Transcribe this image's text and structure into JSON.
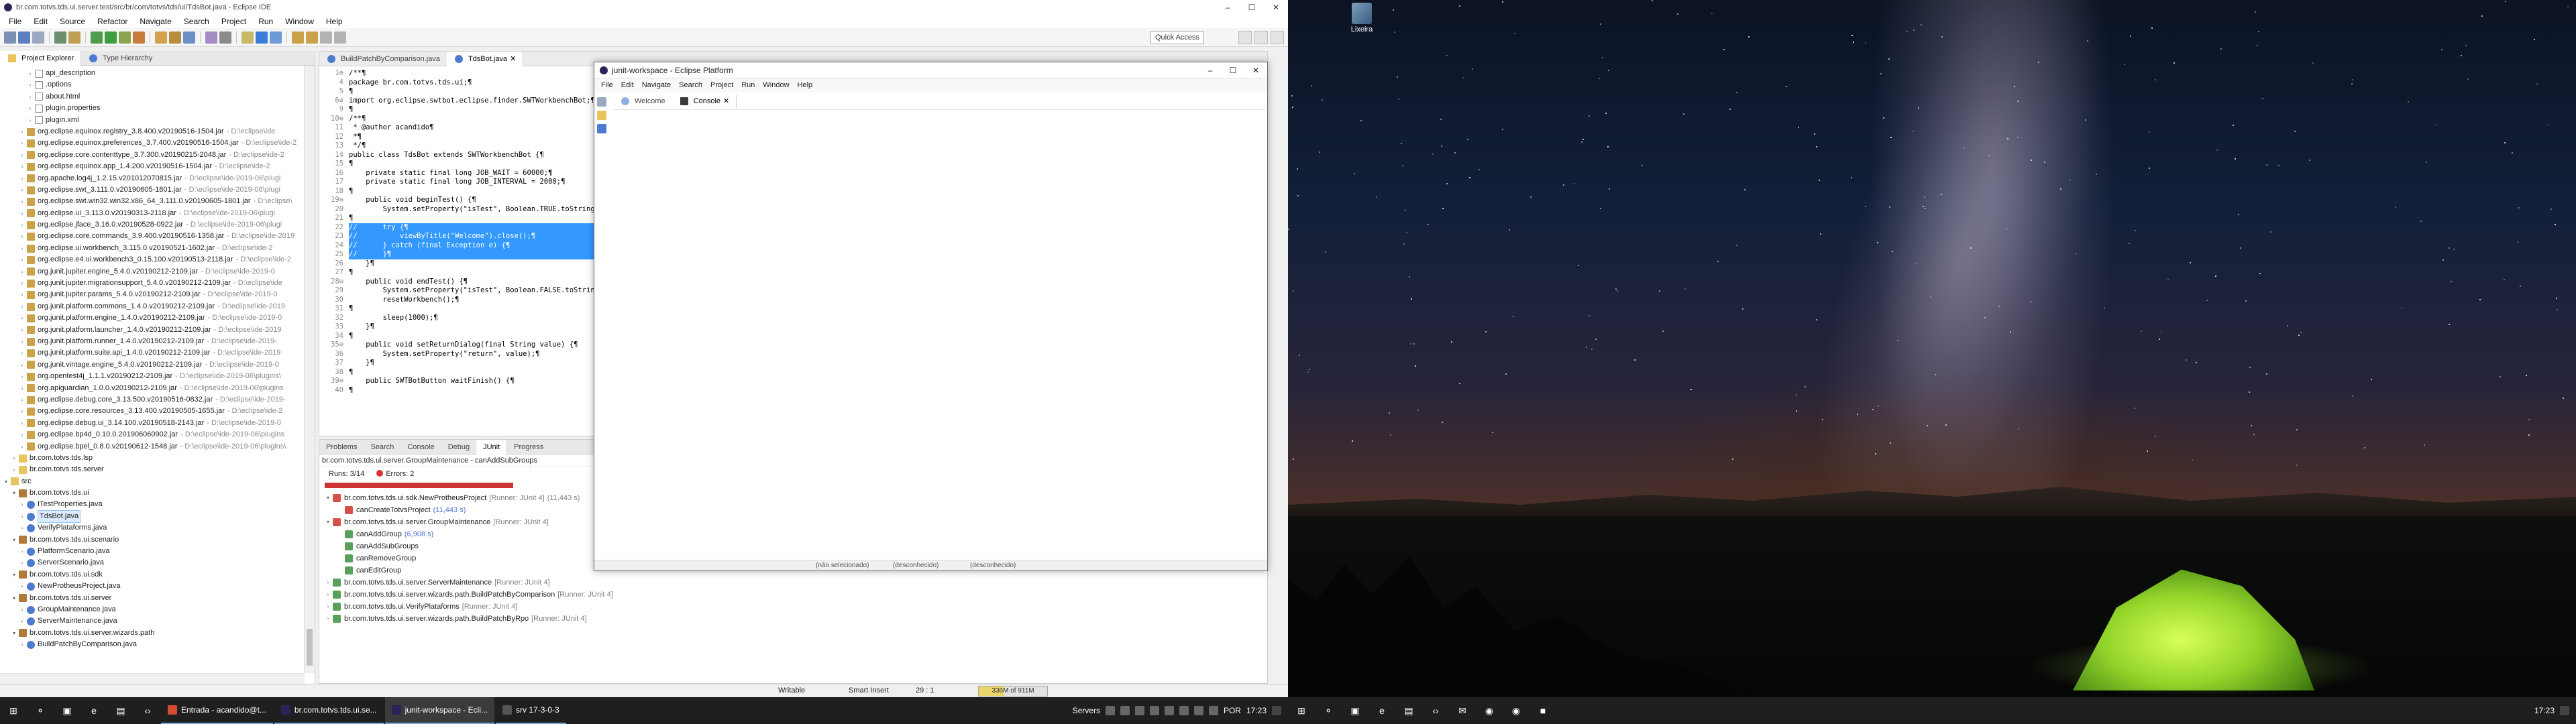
{
  "eclipse": {
    "title": "br.com.totvs.tds.ui.server.test/src/br/com/totvs/tds/ui/TdsBot.java - Eclipse IDE",
    "menu": [
      "File",
      "Edit",
      "Source",
      "Refactor",
      "Navigate",
      "Search",
      "Project",
      "Run",
      "Window",
      "Help"
    ],
    "quick_access": "Quick Access",
    "explorer": {
      "tabs": [
        "Project Explorer",
        "Type Hierarchy"
      ],
      "rows": [
        {
          "indent": 3,
          "icon": "file",
          "label": "api_description"
        },
        {
          "indent": 3,
          "icon": "file",
          "label": ".options"
        },
        {
          "indent": 3,
          "icon": "file",
          "label": "about.html"
        },
        {
          "indent": 3,
          "icon": "file",
          "label": "plugin.properties"
        },
        {
          "indent": 3,
          "icon": "file",
          "label": "plugin.xml"
        },
        {
          "indent": 2,
          "icon": "jar",
          "label": "org.eclipse.equinox.registry_3.8.400.v20190516-1504.jar",
          "path": "- D:\\eclipse\\ide"
        },
        {
          "indent": 2,
          "icon": "jar",
          "label": "org.eclipse.equinox.preferences_3.7.400.v20190516-1504.jar",
          "path": "- D:\\eclipse\\ide-2"
        },
        {
          "indent": 2,
          "icon": "jar",
          "label": "org.eclipse.core.contenttype_3.7.300.v20190215-2048.jar",
          "path": "- D:\\eclipse\\ide-2"
        },
        {
          "indent": 2,
          "icon": "jar",
          "label": "org.eclipse.equinox.app_1.4.200.v20190516-1504.jar",
          "path": "- D:\\eclipse\\ide-2"
        },
        {
          "indent": 2,
          "icon": "jar",
          "label": "org.apache.log4j_1.2.15.v201012070815.jar",
          "path": "- D:\\eclipse\\ide-2019-06\\plugi"
        },
        {
          "indent": 2,
          "icon": "jar",
          "label": "org.eclipse.swt_3.111.0.v20190605-1801.jar",
          "path": "- D:\\eclipse\\ide-2019-06\\plugi"
        },
        {
          "indent": 2,
          "icon": "jar",
          "label": "org.eclipse.swt.win32.win32.x86_64_3.111.0.v20190605-1801.jar",
          "path": "- D:\\eclipse\\"
        },
        {
          "indent": 2,
          "icon": "jar",
          "label": "org.eclipse.ui_3.113.0.v20190313-2118.jar",
          "path": "- D:\\eclipse\\ide-2019-06\\plugi"
        },
        {
          "indent": 2,
          "icon": "jar",
          "label": "org.eclipse.jface_3.16.0.v20190528-0922.jar",
          "path": "- D:\\eclipse\\ide-2019-06\\plugi"
        },
        {
          "indent": 2,
          "icon": "jar",
          "label": "org.eclipse.core.commands_3.9.400.v20190516-1358.jar",
          "path": "- D:\\eclipse\\ide-2019"
        },
        {
          "indent": 2,
          "icon": "jar",
          "label": "org.eclipse.ui.workbench_3.115.0.v20190521-1602.jar",
          "path": "- D:\\eclipse\\ide-2"
        },
        {
          "indent": 2,
          "icon": "jar",
          "label": "org.eclipse.e4.ui.workbench3_0.15.100.v20190513-2118.jar",
          "path": "- D:\\eclipse\\ide-2"
        },
        {
          "indent": 2,
          "icon": "jar",
          "label": "org.junit.jupiter.engine_5.4.0.v20190212-2109.jar",
          "path": "- D:\\eclipse\\ide-2019-0"
        },
        {
          "indent": 2,
          "icon": "jar",
          "label": "org.junit.jupiter.migrationsupport_5.4.0.v20190212-2109.jar",
          "path": "- D:\\eclipse\\ide"
        },
        {
          "indent": 2,
          "icon": "jar",
          "label": "org.junit.jupiter.params_5.4.0.v20190212-2109.jar",
          "path": "- D:\\eclipse\\ide-2019-0"
        },
        {
          "indent": 2,
          "icon": "jar",
          "label": "org.junit.platform.commons_1.4.0.v20190212-2109.jar",
          "path": "- D:\\eclipse\\ide-2019"
        },
        {
          "indent": 2,
          "icon": "jar",
          "label": "org.junit.platform.engine_1.4.0.v20190212-2109.jar",
          "path": "- D:\\eclipse\\ide-2019-0"
        },
        {
          "indent": 2,
          "icon": "jar",
          "label": "org.junit.platform.launcher_1.4.0.v20190212-2109.jar",
          "path": "- D:\\eclipse\\ide-2019"
        },
        {
          "indent": 2,
          "icon": "jar",
          "label": "org.junit.platform.runner_1.4.0.v20190212-2109.jar",
          "path": "- D:\\eclipse\\ide-2019-"
        },
        {
          "indent": 2,
          "icon": "jar",
          "label": "org.junit.platform.suite.api_1.4.0.v20190212-2109.jar",
          "path": "- D:\\eclipse\\ide-2019"
        },
        {
          "indent": 2,
          "icon": "jar",
          "label": "org.junit.vintage.engine_5.4.0.v20190212-2109.jar",
          "path": "- D:\\eclipse\\ide-2019-0"
        },
        {
          "indent": 2,
          "icon": "jar",
          "label": "org.opentest4j_1.1.1.v20190212-2109.jar",
          "path": "- D:\\eclipse\\ide-2019-06\\plugins\\"
        },
        {
          "indent": 2,
          "icon": "jar",
          "label": "org.apiguardian_1.0.0.v20190212-2109.jar",
          "path": "- D:\\eclipse\\ide-2019-06\\plugins"
        },
        {
          "indent": 2,
          "icon": "jar",
          "label": "org.eclipse.debug.core_3.13.500.v20190516-0832.jar",
          "path": "- D:\\eclipse\\ide-2019-"
        },
        {
          "indent": 2,
          "icon": "jar",
          "label": "org.eclipse.core.resources_3.13.400.v20190505-1655.jar",
          "path": "- D:\\eclipse\\ide-2"
        },
        {
          "indent": 2,
          "icon": "jar",
          "label": "org.eclipse.debug.ui_3.14.100.v20190518-2143.jar",
          "path": "- D:\\eclipse\\ide-2019-0"
        },
        {
          "indent": 2,
          "icon": "jar",
          "label": "org.eclipse.bp4d_0.10.0.201906060902.jar",
          "path": "- D:\\eclipse\\ide-2019-06\\plugins"
        },
        {
          "indent": 2,
          "icon": "jar",
          "label": "org.eclipse.bpel_0.8.0.v20190612-1548.jar",
          "path": "- D:\\eclipse\\ide-2019-06\\plugins\\"
        },
        {
          "indent": 1,
          "icon": "folder",
          "label": "br.com.totvs.tds.lsp"
        },
        {
          "indent": 1,
          "icon": "folder",
          "label": "br.com.totvs.tds.server"
        },
        {
          "indent": 0,
          "icon": "folder",
          "label": "src",
          "open": true
        },
        {
          "indent": 1,
          "icon": "pkg",
          "label": "br.com.totvs.tds.ui",
          "open": true
        },
        {
          "indent": 2,
          "icon": "java",
          "label": "ITestProperties.java"
        },
        {
          "indent": 2,
          "icon": "java",
          "label": "TdsBot.java",
          "selected": true
        },
        {
          "indent": 2,
          "icon": "java",
          "label": "VerifyPlataforms.java"
        },
        {
          "indent": 1,
          "icon": "pkg",
          "label": "br.com.totvs.tds.ui.scenario",
          "open": true
        },
        {
          "indent": 2,
          "icon": "java",
          "label": "PlatformScenario.java"
        },
        {
          "indent": 2,
          "icon": "java",
          "label": "ServerScenario.java"
        },
        {
          "indent": 1,
          "icon": "pkg",
          "label": "br.com.totvs.tds.ui.sdk",
          "open": true
        },
        {
          "indent": 2,
          "icon": "java",
          "label": "NewProtheusProject.java"
        },
        {
          "indent": 1,
          "icon": "pkg",
          "label": "br.com.totvs.tds.ui.server",
          "open": true
        },
        {
          "indent": 2,
          "icon": "java",
          "label": "GroupMaintenance.java"
        },
        {
          "indent": 2,
          "icon": "java",
          "label": "ServerMaintenance.java"
        },
        {
          "indent": 1,
          "icon": "pkg",
          "label": "br.com.totvs.tds.ui.server.wizards.path",
          "open": true
        },
        {
          "indent": 2,
          "icon": "java",
          "label": "BuildPatchByComparison.java"
        }
      ]
    },
    "editor": {
      "tabs": [
        "BuildPatchByComparison.java",
        "TdsBot.java"
      ],
      "lines": [
        {
          "n": "1⊕",
          "t": "/**¶"
        },
        {
          "n": "4",
          "t": "package br.com.totvs.tds.ui;¶"
        },
        {
          "n": "5",
          "t": "¶"
        },
        {
          "n": "6⊕",
          "t": "import org.eclipse.swtbot.eclipse.finder.SWTWorkbenchBot;¶"
        },
        {
          "n": "9",
          "t": "¶"
        },
        {
          "n": "10⊕",
          "t": "/**¶"
        },
        {
          "n": "11",
          "t": " * @author acandido¶"
        },
        {
          "n": "12",
          "t": " *¶"
        },
        {
          "n": "13",
          "t": " */¶"
        },
        {
          "n": "14",
          "t": "public class TdsBot extends SWTWorkbenchBot {¶"
        },
        {
          "n": "15",
          "t": "¶"
        },
        {
          "n": "16",
          "t": "    private static final long JOB_WAIT = 60000;¶"
        },
        {
          "n": "17",
          "t": "    private static final long JOB_INTERVAL = 2000;¶"
        },
        {
          "n": "18",
          "t": "¶"
        },
        {
          "n": "19⊖",
          "t": "    public void beginTest() {¶"
        },
        {
          "n": "20",
          "t": "        System.setProperty(\"isTest\", Boolean.TRUE.toString());¶"
        },
        {
          "n": "21",
          "t": "¶"
        },
        {
          "n": "22",
          "t": "//      try {¶",
          "hl": true
        },
        {
          "n": "23",
          "t": "//          viewByTitle(\"Welcome\").close();¶",
          "hl": true
        },
        {
          "n": "24",
          "t": "//      } catch (final Exception e) {¶",
          "hl": true
        },
        {
          "n": "25",
          "t": "//      }¶",
          "hl": true
        },
        {
          "n": "26",
          "t": "    }¶"
        },
        {
          "n": "27",
          "t": "¶"
        },
        {
          "n": "28⊖",
          "t": "    public void endTest() {¶"
        },
        {
          "n": "29",
          "t": "        System.setProperty(\"isTest\", Boolean.FALSE.toString());¶"
        },
        {
          "n": "30",
          "t": "        resetWorkbench();¶"
        },
        {
          "n": "31",
          "t": "¶"
        },
        {
          "n": "32",
          "t": "        sleep(1000);¶"
        },
        {
          "n": "33",
          "t": "    }¶"
        },
        {
          "n": "34",
          "t": "¶"
        },
        {
          "n": "35⊖",
          "t": "    public void setReturnDialog(final String value) {¶"
        },
        {
          "n": "36",
          "t": "        System.setProperty(\"return\", value);¶"
        },
        {
          "n": "37",
          "t": "    }¶"
        },
        {
          "n": "38",
          "t": "¶"
        },
        {
          "n": "39⊖",
          "t": "    public SWTBotButton waitFinish() {¶"
        },
        {
          "n": "40",
          "t": "¶"
        }
      ]
    },
    "junit": {
      "tabs": [
        "Problems",
        "Search",
        "Console",
        "Debug",
        "JUnit",
        "Progress"
      ],
      "path": "br.com.totvs.tds.ui.server.GroupMaintenance - canAddSubGroups",
      "runs": "Runs: 3/14",
      "errors": "Errors: 2",
      "failures": "",
      "progress": 0.21,
      "items": [
        {
          "indent": 0,
          "status": "err",
          "label": "br.com.totvs.tds.ui.sdk.NewProtheusProject",
          "runner": "[Runner: JUnit 4]",
          "time": "(11,443 s)",
          "open": true
        },
        {
          "indent": 1,
          "status": "err",
          "label": "canCreateTotvsProject",
          "time": "(11,443 s)",
          "blue": true
        },
        {
          "indent": 0,
          "status": "err",
          "label": "br.com.totvs.tds.ui.server.GroupMaintenance",
          "runner": "[Runner: JUnit 4]",
          "time": "",
          "open": true
        },
        {
          "indent": 1,
          "status": "ok",
          "label": "canAddGroup",
          "time": "(6,908 s)",
          "blue": true
        },
        {
          "indent": 1,
          "status": "ok",
          "label": "canAddSubGroups",
          "time": ""
        },
        {
          "indent": 1,
          "status": "ok",
          "label": "canRemoveGroup",
          "time": ""
        },
        {
          "indent": 1,
          "status": "ok",
          "label": "canEditGroup",
          "time": ""
        },
        {
          "indent": 0,
          "status": "ok",
          "label": "br.com.totvs.tds.ui.server.ServerMaintenance",
          "runner": "[Runner: JUnit 4]",
          "time": ""
        },
        {
          "indent": 0,
          "status": "ok",
          "label": "br.com.totvs.tds.ui.server.wizards.path.BuildPatchByComparison",
          "runner": "[Runner: JUnit 4]",
          "time": ""
        },
        {
          "indent": 0,
          "status": "ok",
          "label": "br.com.totvs.tds.ui.VerifyPlataforms",
          "runner": "[Runner: JUnit 4]",
          "time": ""
        },
        {
          "indent": 0,
          "status": "ok",
          "label": "br.com.totvs.tds.ui.server.wizards.path.BuildPatchByRpo",
          "runner": "[Runner: JUnit 4]",
          "time": ""
        }
      ]
    },
    "status": {
      "writable": "Writable",
      "insert": "Smart Insert",
      "position": "29 : 1",
      "heap": "336M of 911M",
      "heap_fill": 0.37
    }
  },
  "junit_workspace": {
    "title": "junit-workspace - Eclipse Platform",
    "menu": [
      "File",
      "Edit",
      "Navigate",
      "Search",
      "Project",
      "Run",
      "Window",
      "Help"
    ],
    "tabs": [
      "Welcome",
      "Console"
    ],
    "status": [
      "(não selecionado)",
      "(desconhecido)",
      "(desconhecido)"
    ]
  },
  "taskbar1": {
    "items": [
      {
        "label": "Entrada - acandido@t...",
        "color": "#d54d2e"
      },
      {
        "label": "br.com.totvs.tds.ui.se...",
        "color": "#2c2255"
      },
      {
        "label": "junit-workspace - Ecli...",
        "color": "#2c2255",
        "active": true
      },
      {
        "label": "srv 17-3-0-3",
        "color": "#555555"
      }
    ],
    "tray": {
      "label": "Servers",
      "lang": "POR",
      "time": "17:23"
    }
  },
  "taskbar2": {
    "tray": {
      "time": "17:23"
    }
  },
  "desktop2": {
    "icon_label": "Lixeira"
  }
}
